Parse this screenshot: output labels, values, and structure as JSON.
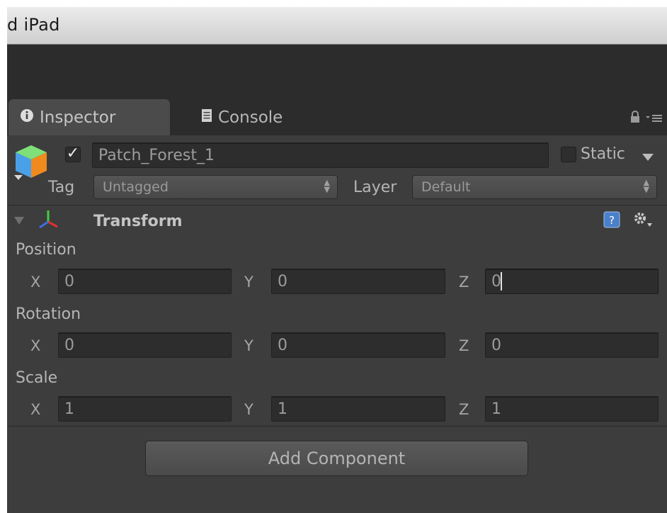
{
  "window": {
    "title": "d iPad"
  },
  "tabs": [
    {
      "label": "Inspector",
      "icon": "info-icon",
      "active": true
    },
    {
      "label": "Console",
      "icon": "console-icon",
      "active": false
    }
  ],
  "object": {
    "enabled": true,
    "name": "Patch_Forest_1",
    "static_label": "Static",
    "tag_label": "Tag",
    "tag_value": "Untagged",
    "layer_label": "Layer",
    "layer_value": "Default"
  },
  "transform": {
    "title": "Transform",
    "position": {
      "label": "Position",
      "x": "0",
      "y": "0",
      "z": "0"
    },
    "rotation": {
      "label": "Rotation",
      "x": "0",
      "y": "0",
      "z": "0"
    },
    "scale": {
      "label": "Scale",
      "x": "1",
      "y": "1",
      "z": "1"
    },
    "axes": {
      "x": "X",
      "y": "Y",
      "z": "Z"
    }
  },
  "add_component_label": "Add Component",
  "colors": {
    "background": "#3d3d3d",
    "field": "#2d2d2d",
    "titlebar": "#dedede"
  }
}
